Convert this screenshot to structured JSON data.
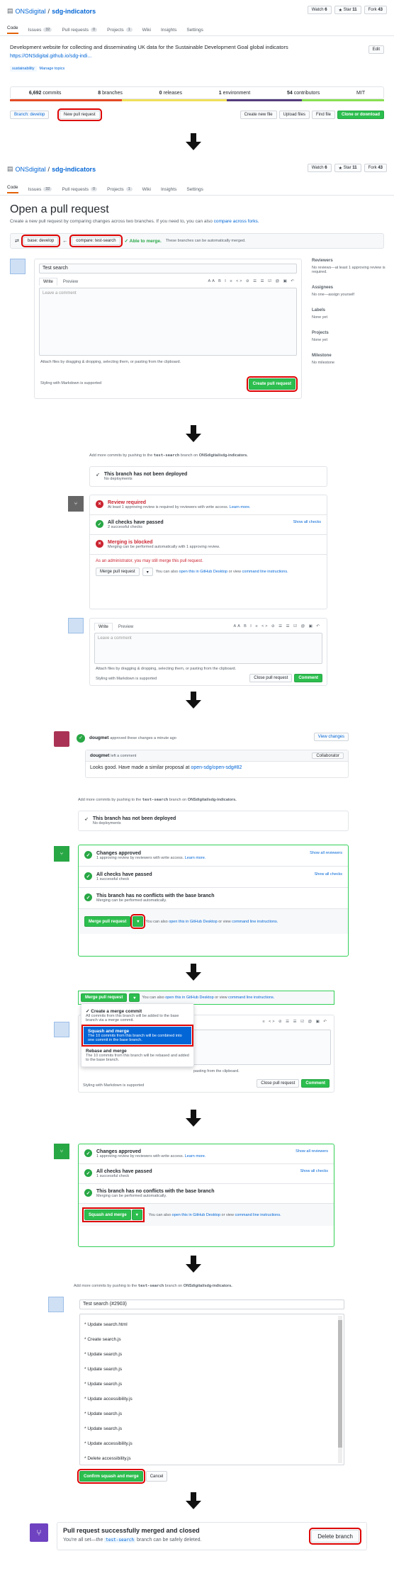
{
  "repo": {
    "owner": "ONSdigital",
    "name": "sdg-indicators",
    "watch": "Watch",
    "watch_count": "6",
    "star": "Star",
    "star_count": "11",
    "fork": "Fork",
    "fork_count": "43"
  },
  "tabs": [
    {
      "label": "Code"
    },
    {
      "label": "Issues",
      "count": "32"
    },
    {
      "label": "Pull requests",
      "count": "0"
    },
    {
      "label": "Projects",
      "count": "1"
    },
    {
      "label": "Wiki"
    },
    {
      "label": "Insights"
    },
    {
      "label": "Settings"
    }
  ],
  "desc": {
    "text": "Development website for collecting and disseminating UK data for the Sustainable Development Goal global indicators",
    "url": "https://ONSdigital.github.io/sdg-indi...",
    "edit": "Edit",
    "topic": "sustainability",
    "manage": "Manage topics"
  },
  "stats": {
    "commits": "6,692",
    "commits_l": "commits",
    "branches": "8",
    "branches_l": "branches",
    "releases": "0",
    "releases_l": "releases",
    "env": "1",
    "env_l": "environment",
    "contrib": "54",
    "contrib_l": "contributors",
    "license": "MIT"
  },
  "toolbar": {
    "branch": "Branch: develop",
    "new_pr": "New pull request",
    "create_file": "Create new file",
    "upload": "Upload files",
    "find": "Find file",
    "clone": "Clone or download"
  },
  "open_pr": {
    "title": "Open a pull request",
    "sub": "Create a new pull request by comparing changes across two branches. If you need to, you can also",
    "compare_link": "compare across forks.",
    "base": "base: develop",
    "compare": "compare: test-search",
    "able": "✓ Able to merge.",
    "able_rest": "These branches can be automatically merged.",
    "pr_title": "Test search",
    "write": "Write",
    "preview": "Preview",
    "leave": "Leave a comment",
    "attach": "Attach files by dragging & dropping, selecting them, or pasting from the clipboard.",
    "md": "Styling with Markdown is supported",
    "create": "Create pull request"
  },
  "sidebar": {
    "reviewers": "Reviewers",
    "reviewers_note": "No reviews—at least 1 approving review is required.",
    "assignees": "Assignees",
    "assignees_note": "No one—assign yourself",
    "labels": "Labels",
    "labels_note": "None yet",
    "projects": "Projects",
    "projects_note": "None yet",
    "milestone": "Milestone",
    "milestone_note": "No milestone"
  },
  "pr1": {
    "note": "Add more commits by pushing to the",
    "branch": "test-search",
    "note2": "branch on",
    "repo": "ONSdigital/sdg-indicators.",
    "deploy": "This branch has not been deployed",
    "deploy_sub": "No deployments",
    "review": "Review required",
    "review_sub": "At least 1 approving review is required by reviewers with write access.",
    "learn": "Learn more.",
    "checks": "All checks have passed",
    "checks_sub": "2 successful checks",
    "show_checks": "Show all checks",
    "blocked": "Merging is blocked",
    "blocked_sub": "Merging can be performed automatically with 1 approving review.",
    "admin": "As an administrator, you may still merge this pull request.",
    "merge": "Merge pull request",
    "also": "You can also",
    "desktop": "open this in GitHub Desktop",
    "or": "or view",
    "cli": "command line instructions.",
    "write": "Write",
    "preview": "Preview",
    "leave": "Leave a comment",
    "attach": "Attach files by dragging & dropping, selecting them, or pasting from the clipboard.",
    "md": "Styling with Markdown is supported",
    "close": "Close pull request",
    "comment": "Comment"
  },
  "pr2": {
    "approved_user": "dougmet",
    "approved": "approved these changes a minute ago",
    "view": "View changes",
    "comment_user": "dougmet",
    "left": "left a comment",
    "collab": "Collaborator",
    "body": "Looks good. Have made a similar proposal at",
    "body_link": "open-sdg/open-sdg#82",
    "note": "Add more commits by pushing to the",
    "branch": "test-search",
    "note2": "branch on",
    "repo": "ONSdigital/sdg-indicators.",
    "deploy": "This branch has not been deployed",
    "deploy_sub": "No deployments",
    "changes": "Changes approved",
    "changes_sub": "1 approving review by reviewers with write access.",
    "learn": "Learn more.",
    "show_rev": "Show all reviewers",
    "checks": "All checks have passed",
    "checks_sub": "1 successful check",
    "show_checks": "Show all checks",
    "noconf": "This branch has no conflicts with the base branch",
    "noconf_sub": "Merging can be performed automatically.",
    "merge": "Merge pull request",
    "also": "You can also",
    "desktop": "open this in GitHub Desktop",
    "or": "or view",
    "cli": "command line instructions."
  },
  "menu": {
    "merge": "Merge pull request",
    "also": "You can also",
    "desktop": "open this in GitHub Desktop",
    "or": "or view",
    "cli": "command line instructions.",
    "items": [
      {
        "title": "✓ Create a merge commit",
        "desc": "All commits from this branch will be added to the base branch via a merge commit."
      },
      {
        "title": "Squash and merge",
        "desc": "The 10 commits from this branch will be combined into one commit in the base branch."
      },
      {
        "title": "Rebase and merge",
        "desc": "The 10 commits from this branch will be rebased and added to the base branch."
      }
    ],
    "paste": "pasting from the clipboard.",
    "md": "Styling with Markdown is supported",
    "close": "Close pull request",
    "comment": "Comment"
  },
  "sq": {
    "changes": "Changes approved",
    "changes_sub": "1 approving review by reviewers with write access.",
    "learn": "Learn more.",
    "show_rev": "Show all reviewers",
    "checks": "All checks have passed",
    "checks_sub": "1 successful check",
    "show_checks": "Show all checks",
    "noconf": "This branch has no conflicts with the base branch",
    "noconf_sub": "Merging can be performed automatically.",
    "btn": "Squash and merge",
    "also": "You can also",
    "desktop": "open this in GitHub Desktop",
    "or": "or view",
    "cli": "command line instructions."
  },
  "confirm": {
    "note": "Add more commits by pushing to the",
    "branch": "test-search",
    "note2": "branch on",
    "repo": "ONSdigital/sdg-indicators.",
    "title": "Test search (#2903)",
    "commits": [
      "* Update search.html",
      "* Create search.js",
      "* Update search.js",
      "* Update search.js",
      "* Update search.js",
      "* Update accessibility.js",
      "* Update search.js",
      "* Update search.js",
      "* Update accessibility.js",
      "* Delete accessibility.js"
    ],
    "confirm": "Confirm squash and merge",
    "cancel": "Cancel"
  },
  "done": {
    "title": "Pull request successfully merged and closed",
    "sub1": "You're all set—the",
    "branch": "test-search",
    "sub2": "branch can be safely deleted.",
    "delete": "Delete branch"
  }
}
